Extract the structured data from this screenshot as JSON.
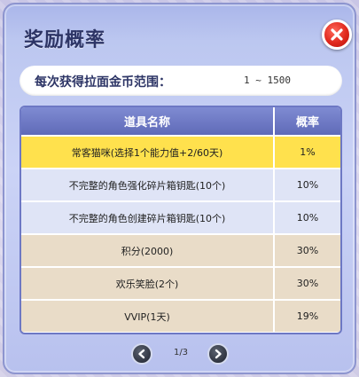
{
  "dialog": {
    "title": "奖励概率",
    "close_icon": "close-icon"
  },
  "range": {
    "label": "每次获得拉面金币范围：",
    "value": "1 ~ 1500"
  },
  "table": {
    "headers": {
      "name": "道具名称",
      "rate": "概率"
    },
    "rows": [
      {
        "name": "常客猫咪(选择1个能力值+2/60天)",
        "rate": "1%",
        "style": "highlight"
      },
      {
        "name": "不完整的角色强化碎片箱钥匙(10个)",
        "rate": "10%",
        "style": "blue"
      },
      {
        "name": "不完整的角色创建碎片箱钥匙(10个)",
        "rate": "10%",
        "style": "blue"
      },
      {
        "name": "积分(2000)",
        "rate": "30%",
        "style": "tan"
      },
      {
        "name": "欢乐笑脸(2个)",
        "rate": "30%",
        "style": "tan"
      },
      {
        "name": "VVIP(1天)",
        "rate": "19%",
        "style": "tan"
      }
    ]
  },
  "pager": {
    "text": "1/3",
    "prev_icon": "chevron-left-icon",
    "next_icon": "chevron-right-icon"
  }
}
